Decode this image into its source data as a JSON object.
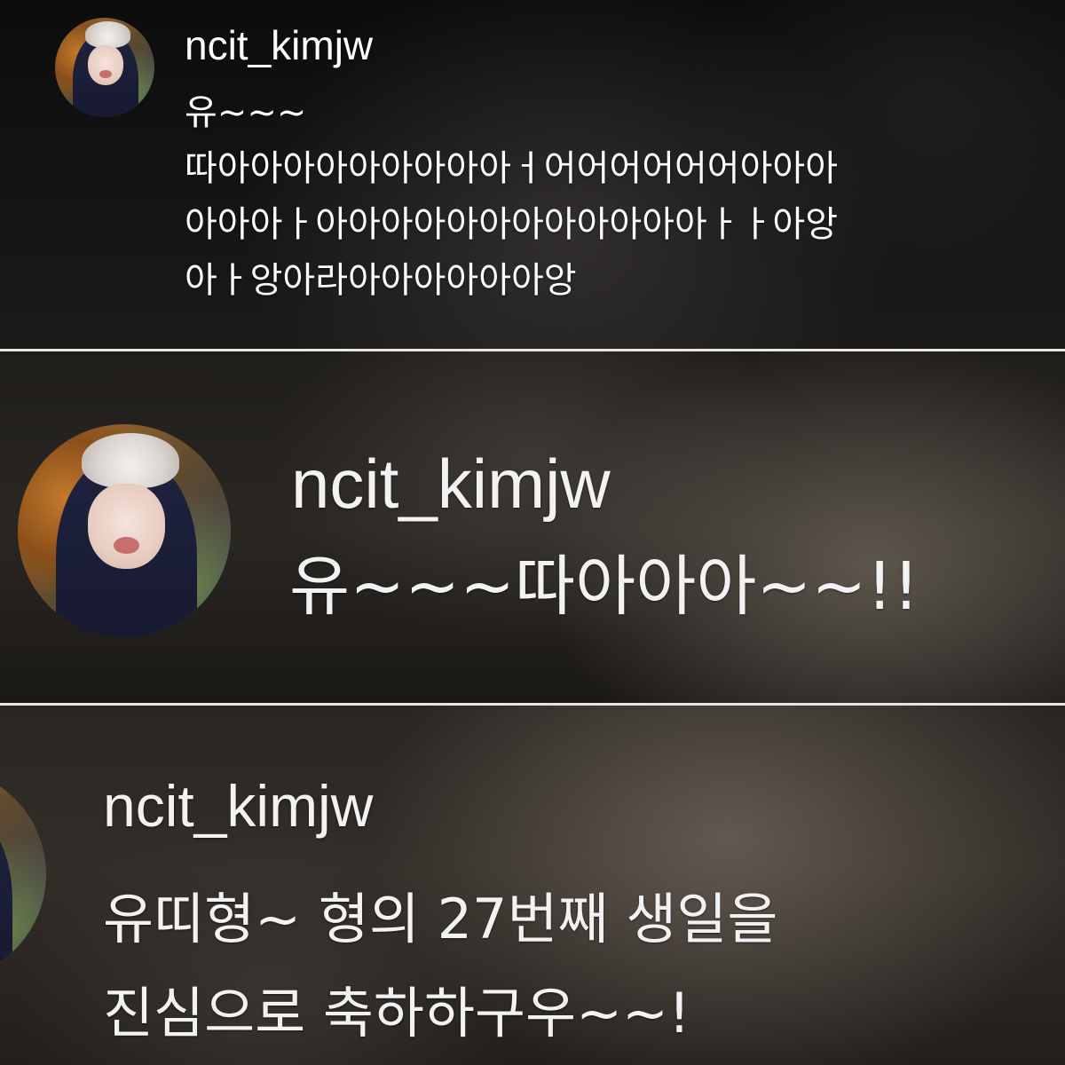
{
  "panels": [
    {
      "username": "ncit_kimjw",
      "comment_lines": [
        "유~~~",
        "따아아아아아아아아아ㅓ어어어어어어아아아",
        "아아아ㅏ아아아아아아아아아아아아ㅏㅏ아앙",
        "아ㅏ앙아라아아아아아아앙"
      ]
    },
    {
      "username": "ncit_kimjw",
      "comment_lines": [
        "유~~~따아아아~~!!"
      ]
    },
    {
      "username": "ncit_kimjw",
      "comment_lines": [
        "유띠형~ 형의 27번째 생일을",
        "진심으로 축하하구우~~!"
      ]
    }
  ]
}
